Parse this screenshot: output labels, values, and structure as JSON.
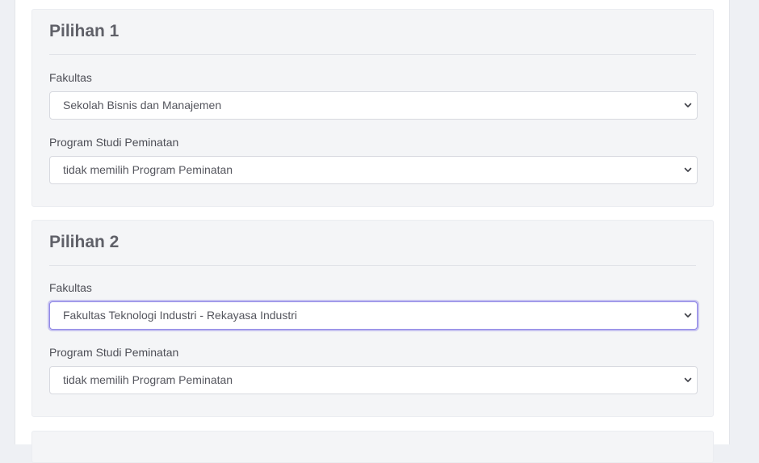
{
  "pilihan_1": {
    "title": "Pilihan 1",
    "fakultas_label": "Fakultas",
    "fakultas_value": "Sekolah Bisnis dan Manajemen",
    "prodi_label": "Program Studi Peminatan",
    "prodi_value": "tidak memilih Program Peminatan"
  },
  "pilihan_2": {
    "title": "Pilihan 2",
    "fakultas_label": "Fakultas",
    "fakultas_value": "Fakultas Teknologi Industri - Rekayasa Industri",
    "prodi_label": "Program Studi Peminatan",
    "prodi_value": "tidak memilih Program Peminatan"
  },
  "icons": {
    "select_arrow": "chevron-down-icon"
  },
  "colors": {
    "focus_ring": "#8f86e6",
    "card_background": "#f4f5f7",
    "page_background": "#eef0f4"
  }
}
